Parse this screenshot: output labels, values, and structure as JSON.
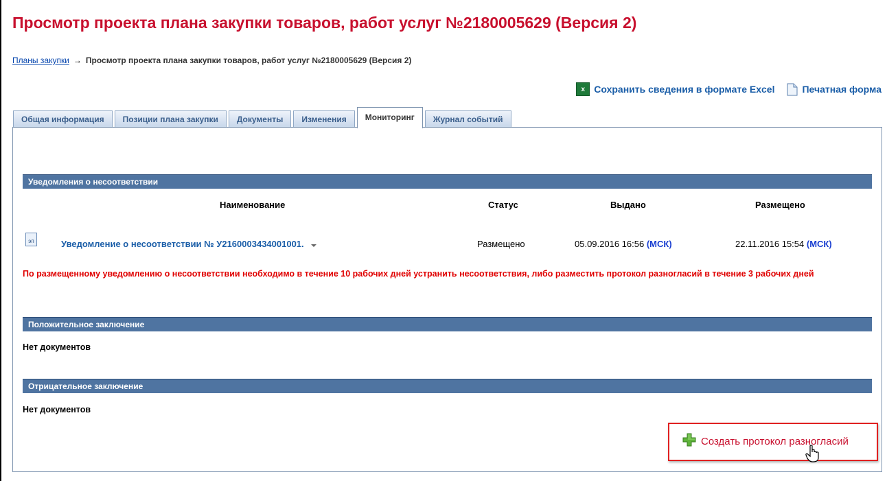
{
  "page": {
    "title": "Просмотр проекта плана закупки товаров, работ услуг №2180005629 (Версия 2)"
  },
  "breadcrumb": {
    "link": "Планы закупки",
    "arrow": "→",
    "current": "Просмотр проекта плана закупки товаров, работ услуг №2180005629 (Версия 2)"
  },
  "actions": {
    "excel_icon_text": "x",
    "excel_label": "Сохранить сведения в формате Excel",
    "print_label": "Печатная форма"
  },
  "tabs": [
    {
      "label": "Общая информация"
    },
    {
      "label": "Позиции плана закупки"
    },
    {
      "label": "Документы"
    },
    {
      "label": "Изменения"
    },
    {
      "label": "Мониторинг",
      "active": true
    },
    {
      "label": "Журнал событий"
    }
  ],
  "sections": {
    "notices": {
      "header": "Уведомления о несоответствии",
      "columns": {
        "name": "Наименование",
        "status": "Статус",
        "issued": "Выдано",
        "posted": "Размещено"
      },
      "row": {
        "icon_text": "эп",
        "name": "Уведомление о несоответствии № У2160003434001001.",
        "status": "Размещено",
        "issued": "05.09.2016 16:56",
        "posted": "22.11.2016 15:54",
        "tz": "(МСК)"
      },
      "warning": "По размещенному уведомлению о несоответствии необходимо в течение 10 рабочих дней устранить несоответствия, либо разместить протокол разногласий в течение 3 рабочих дней"
    },
    "positive": {
      "header": "Положительное заключение",
      "empty": "Нет документов"
    },
    "negative": {
      "header": "Отрицательное заключение",
      "empty": "Нет документов"
    }
  },
  "create_button": {
    "label": "Создать протокол разногласий"
  },
  "colors": {
    "title": "#c8102e",
    "link": "#1b5ea8",
    "section_bar": "#4f74a1",
    "warning": "#e00000",
    "highlight_border": "#e02020"
  }
}
